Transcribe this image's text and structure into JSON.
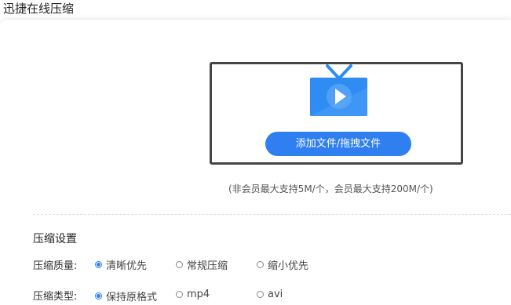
{
  "app": {
    "title": "迅捷在线压缩"
  },
  "upload": {
    "button_label": "添加文件/拖拽文件",
    "limit_note": "(非会员最大支持5M/个，会员最大支持200M/个)"
  },
  "settings": {
    "title": "压缩设置",
    "quality": {
      "label": "压缩质量:",
      "options": [
        "清晰优先",
        "常规压缩",
        "缩小优先"
      ],
      "selected": "清晰优先"
    },
    "type": {
      "label": "压缩类型:",
      "options": [
        "保持原格式",
        "mp4",
        "avi"
      ],
      "selected": "保持原格式"
    }
  },
  "colors": {
    "accent": "#2f7ff0",
    "icon_blue": "#2f8cf3"
  }
}
